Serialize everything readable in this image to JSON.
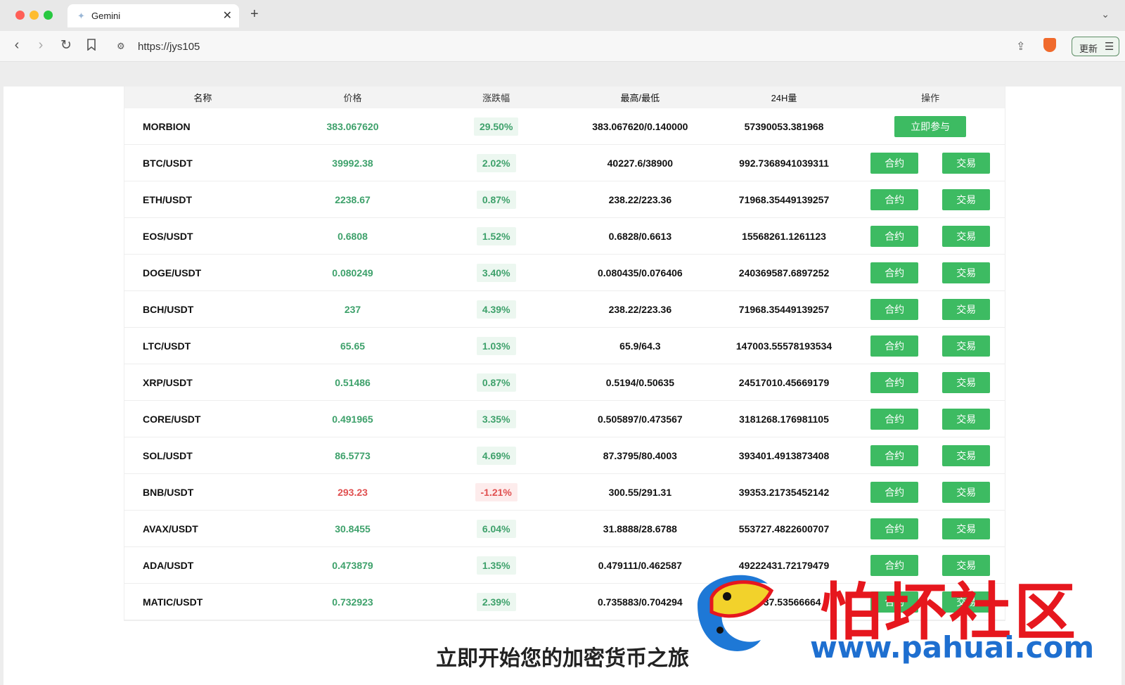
{
  "browser": {
    "tab_title": "Gemini",
    "tab_close": "✕",
    "new_tab": "+",
    "tab_menu": "⌄",
    "url": "https://jys105",
    "update_label": "更新"
  },
  "table": {
    "headers": [
      "名称",
      "价格",
      "涨跌幅",
      "最高/最低",
      "24H量",
      "操作"
    ],
    "rows": [
      {
        "name": "MORBION",
        "price": "383.067620",
        "change": "29.50%",
        "hl": "383.067620/0.140000",
        "vol": "57390053.381968",
        "dir": "up",
        "featured": true,
        "join_label": "立即参与"
      },
      {
        "name": "BTC/USDT",
        "price": "39992.38",
        "change": "2.02%",
        "hl": "40227.6/38900",
        "vol": "992.7368941039311",
        "dir": "up"
      },
      {
        "name": "ETH/USDT",
        "price": "2238.67",
        "change": "0.87%",
        "hl": "238.22/223.36",
        "vol": "71968.35449139257",
        "dir": "up"
      },
      {
        "name": "EOS/USDT",
        "price": "0.6808",
        "change": "1.52%",
        "hl": "0.6828/0.6613",
        "vol": "15568261.1261123",
        "dir": "up"
      },
      {
        "name": "DOGE/USDT",
        "price": "0.080249",
        "change": "3.40%",
        "hl": "0.080435/0.076406",
        "vol": "240369587.6897252",
        "dir": "up"
      },
      {
        "name": "BCH/USDT",
        "price": "237",
        "change": "4.39%",
        "hl": "238.22/223.36",
        "vol": "71968.35449139257",
        "dir": "up"
      },
      {
        "name": "LTC/USDT",
        "price": "65.65",
        "change": "1.03%",
        "hl": "65.9/64.3",
        "vol": "147003.55578193534",
        "dir": "up"
      },
      {
        "name": "XRP/USDT",
        "price": "0.51486",
        "change": "0.87%",
        "hl": "0.5194/0.50635",
        "vol": "24517010.45669179",
        "dir": "up"
      },
      {
        "name": "CORE/USDT",
        "price": "0.491965",
        "change": "3.35%",
        "hl": "0.505897/0.473567",
        "vol": "3181268.176981105",
        "dir": "up"
      },
      {
        "name": "SOL/USDT",
        "price": "86.5773",
        "change": "4.69%",
        "hl": "87.3795/80.4003",
        "vol": "393401.4913873408",
        "dir": "up"
      },
      {
        "name": "BNB/USDT",
        "price": "293.23",
        "change": "-1.21%",
        "hl": "300.55/291.31",
        "vol": "39353.21735452142",
        "dir": "down"
      },
      {
        "name": "AVAX/USDT",
        "price": "30.8455",
        "change": "6.04%",
        "hl": "31.8888/28.6788",
        "vol": "553727.4822600707",
        "dir": "up"
      },
      {
        "name": "ADA/USDT",
        "price": "0.473879",
        "change": "1.35%",
        "hl": "0.479111/0.462587",
        "vol": "49222431.72179479",
        "dir": "up"
      },
      {
        "name": "MATIC/USDT",
        "price": "0.732923",
        "change": "2.39%",
        "hl": "0.735883/0.704294",
        "vol": "33337.53566664",
        "dir": "up"
      }
    ],
    "contract_label": "合约",
    "trade_label": "交易"
  },
  "subtitle": "立即开始您的加密货币之旅",
  "watermark": {
    "brand": "怕坏社区",
    "url": "www.pahuai.com"
  },
  "colors": {
    "up": "#3ea16b",
    "down": "#e05050",
    "button": "#3dbb62"
  }
}
